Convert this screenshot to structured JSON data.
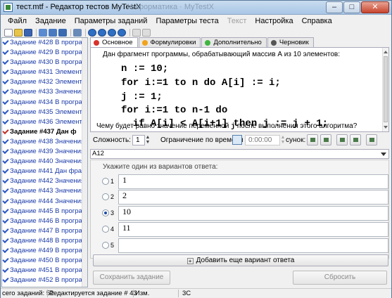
{
  "window": {
    "title": "тест.mtf - Редактор тестов MyTestX",
    "ghost_title": "Информатика · MyTestX"
  },
  "menu": [
    {
      "label": "Файл",
      "enabled": true
    },
    {
      "label": "Задание",
      "enabled": true
    },
    {
      "label": "Параметры заданий",
      "enabled": true
    },
    {
      "label": "Параметры теста",
      "enabled": true
    },
    {
      "label": "Текст",
      "enabled": false
    },
    {
      "label": "Настройка",
      "enabled": true
    },
    {
      "label": "Справка",
      "enabled": true
    }
  ],
  "questions": [
    {
      "label": "Задание #428 В програ"
    },
    {
      "label": "Задание #429 В програ"
    },
    {
      "label": "Задание #430 В програ"
    },
    {
      "label": "Задание #431 Элемента"
    },
    {
      "label": "Задание #432 Элемента"
    },
    {
      "label": "Задание #433 Значения"
    },
    {
      "label": "Задание #434 В програ"
    },
    {
      "label": "Задание #435 Элемента"
    },
    {
      "label": "Задание #436 Элемента"
    },
    {
      "label": "Задание #437 Дан ф",
      "current": true
    },
    {
      "label": "Задание #438 Значения"
    },
    {
      "label": "Задание #439 Значения"
    },
    {
      "label": "Задание #440 Значения"
    },
    {
      "label": "Задание #441 Дан фраг"
    },
    {
      "label": "Задание #442 Значения"
    },
    {
      "label": "Задание #443 Значения"
    },
    {
      "label": "Задание #444 Значения"
    },
    {
      "label": "Задание #445 В програ"
    },
    {
      "label": "Задание #446 В програ"
    },
    {
      "label": "Задание #447 В програ"
    },
    {
      "label": "Задание #448 В програ"
    },
    {
      "label": "Задание #449 В програ"
    },
    {
      "label": "Задание #450 В програ"
    },
    {
      "label": "Задание #451 В програ"
    },
    {
      "label": "Задание #452 В програ"
    }
  ],
  "tabs": [
    {
      "label": "Основное",
      "color": "#d9312b",
      "active": true
    },
    {
      "label": "Формулировки",
      "color": "#f2a31c",
      "active": false
    },
    {
      "label": "Дополнительно",
      "color": "#3fb53f",
      "active": false
    },
    {
      "label": "Черновик",
      "color": "#555555",
      "active": false
    }
  ],
  "editor": {
    "intro": "Дан фрагмент программы, обрабатывающий массив А из 10 элементов:",
    "code": [
      "n := 10;",
      "for i:=1 to n do A[i] := i;",
      "j := 1;",
      "for i:=1 to n-1 do",
      "  if A[i] < A[i+1] then j := j + 1;"
    ],
    "question_before": "Чему будет равно значение переменной ",
    "question_var": "j",
    "question_after": " после выполнения этого алгоритма?"
  },
  "settings": {
    "difficulty_label": "Сложность:",
    "difficulty_value": "1",
    "time_limit_label": "Ограничение по времени",
    "time_value": "0:00:00",
    "picture_label": "сунок:"
  },
  "answer_type": "A12",
  "answers": {
    "prompt": "Укажите один из вариантов ответа:",
    "options": [
      {
        "num": "1",
        "text": "1",
        "selected": false
      },
      {
        "num": "2",
        "text": "2",
        "selected": false
      },
      {
        "num": "3",
        "text": "10",
        "selected": true
      },
      {
        "num": "4",
        "text": "11",
        "selected": false
      },
      {
        "num": "5",
        "text": "",
        "selected": false
      }
    ],
    "add_label": "Добавить еще вариант ответа"
  },
  "actions": {
    "save_label": "Сохранить задание",
    "reset_label": "Сбросить"
  },
  "status": {
    "total": "сего заданий: 51",
    "editing": "Редактируется задание # 43",
    "modified": "Изм.",
    "mode": "3С"
  }
}
